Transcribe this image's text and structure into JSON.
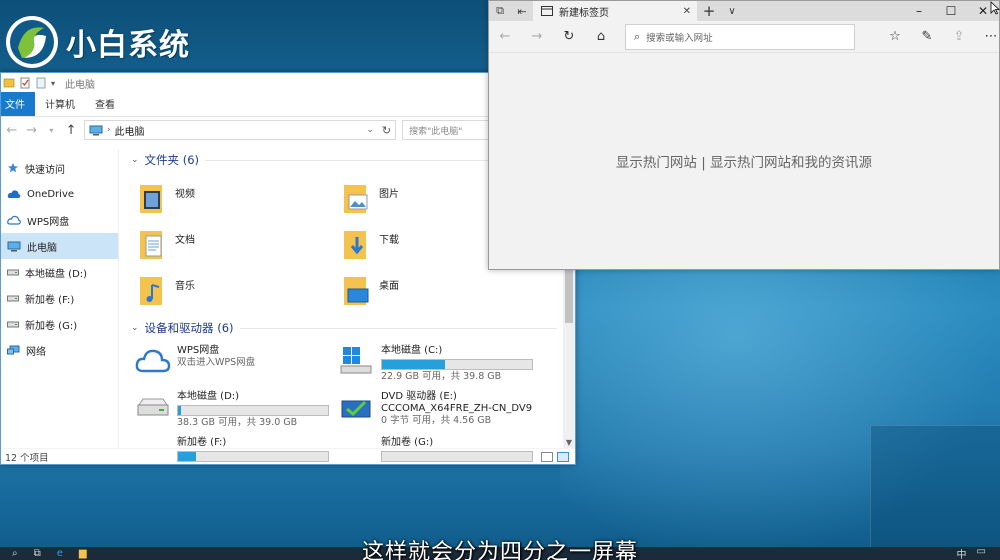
{
  "logo": {
    "text": "小白系统",
    "icon": "logo-mark"
  },
  "explorer": {
    "title": "此电脑",
    "ribbon_tabs": [
      "文件",
      "计算机",
      "查看"
    ],
    "address": "此电脑",
    "search_placeholder": "搜索\"此电脑\"",
    "nav": [
      {
        "label": "快速访问",
        "icon": "star-icon"
      },
      {
        "label": "OneDrive",
        "icon": "cloud-icon"
      },
      {
        "label": "WPS网盘",
        "icon": "wps-cloud-icon"
      },
      {
        "label": "此电脑",
        "icon": "computer-icon",
        "selected": true
      },
      {
        "label": "本地磁盘 (D:)",
        "icon": "drive-icon"
      },
      {
        "label": "新加卷 (F:)",
        "icon": "drive-icon"
      },
      {
        "label": "新加卷 (G:)",
        "icon": "drive-icon"
      },
      {
        "label": "网络",
        "icon": "network-icon"
      }
    ],
    "folders_header": "文件夹 (6)",
    "folders": [
      "视频",
      "图片",
      "文档",
      "下载",
      "音乐",
      "桌面"
    ],
    "devices_header": "设备和驱动器 (6)",
    "devices": [
      {
        "name": "WPS网盘",
        "sub": "双击进入WPS网盘",
        "icon": "wps-cloud-icon"
      },
      {
        "name": "本地磁盘 (C:)",
        "sub": "22.9 GB 可用，共 39.8 GB",
        "usage": 0.42,
        "icon": "windows-drive-icon"
      },
      {
        "name": "本地磁盘 (D:)",
        "sub": "38.3 GB 可用，共 39.0 GB",
        "usage": 0.02,
        "icon": "drive-icon"
      },
      {
        "name": "DVD 驱动器 (E:)",
        "name2": "CCCOMA_X64FRE_ZH-CN_DV9",
        "sub": "0 字节 可用，共 4.56 GB",
        "icon": "dvd-icon"
      },
      {
        "name": "新加卷 (F:)",
        "usage": 0.12,
        "icon": "drive-icon"
      },
      {
        "name": "新加卷 (G:)",
        "usage": 0.0,
        "icon": "drive-icon"
      }
    ],
    "status": "12 个项目"
  },
  "edge": {
    "tab_title": "新建标签页",
    "address_placeholder": "搜索或输入网址",
    "page_message": "显示热门网站 | 显示热门网站和我的资讯源"
  },
  "caption": "这样就会分为四分之一屏幕",
  "taskbar": {
    "lang": "中"
  },
  "colors": {
    "accent": "#1979ca",
    "selection": "#cce4f7",
    "drive_bar": "#26a0da",
    "group_header": "#1e3c8c"
  }
}
